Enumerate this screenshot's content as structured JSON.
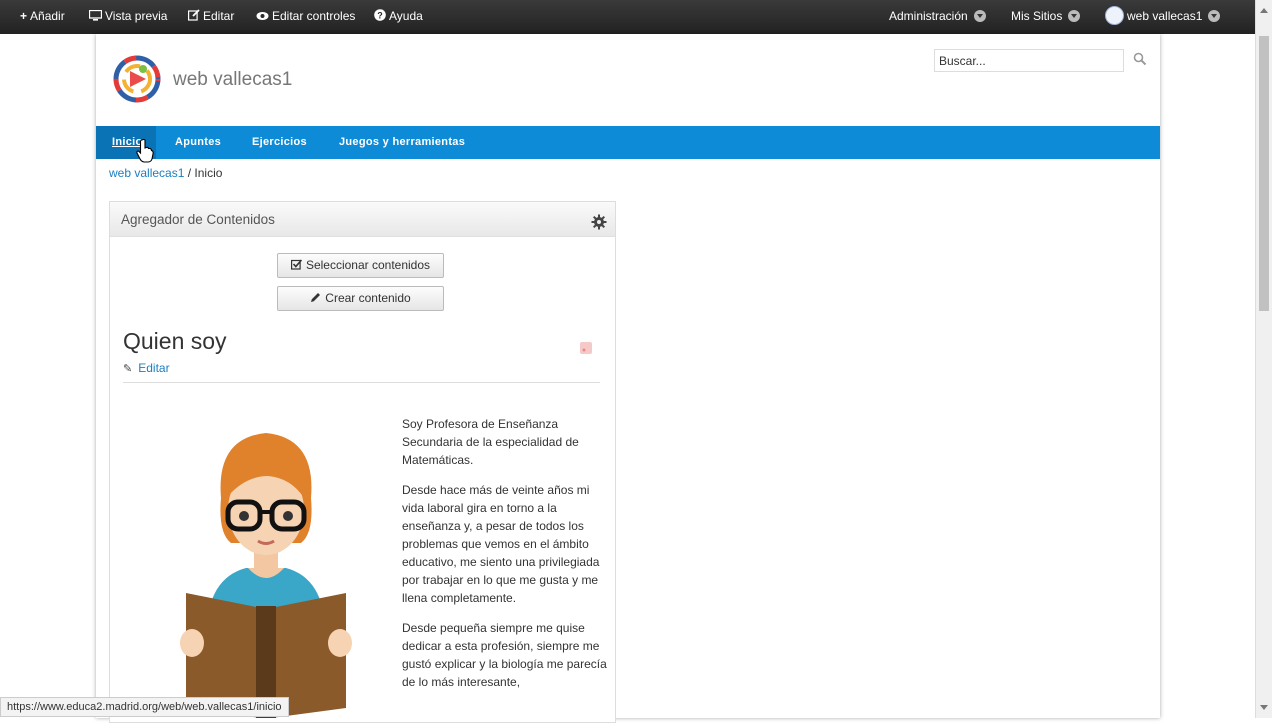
{
  "topbar": {
    "add": "Añadir",
    "preview": "Vista previa",
    "edit": "Editar",
    "edit_controls": "Editar controles",
    "help": "Ayuda",
    "admin": "Administración",
    "my_sites": "Mis Sitios",
    "user": "web vallecas1"
  },
  "header": {
    "site_name": "web vallecas1",
    "search_value": "Buscar..."
  },
  "nav": {
    "items": [
      "Inicio",
      "Apuntes",
      "Ejercicios",
      "Juegos y herramientas"
    ],
    "active": "Inicio"
  },
  "breadcrumb": {
    "site": "web vallecas1",
    "separator": "/",
    "current": "Inicio"
  },
  "portlet": {
    "title": "Agregador de Contenidos",
    "select_button": "Seleccionar contenidos",
    "create_button": "Crear contenido",
    "article_title": "Quien soy",
    "edit_link": "Editar",
    "paragraphs": [
      "Soy Profesora de Enseñanza Secundaria de la especialidad de Matemáticas.",
      "Desde hace más de veinte años mi vida laboral gira en torno a la enseñanza y, a pesar de todos los problemas que vemos en el ámbito educativo, me siento una privilegiada por trabajar en lo que me gusta y me llena completamente.",
      "Desde pequeña siempre me quise dedicar a esta profesión, siempre me gustó explicar y la biología me parecía de lo más interesante,"
    ]
  },
  "status_bar": {
    "url": "https://www.educa2.madrid.org/web/web.vallecas1/inicio"
  },
  "colors": {
    "nav_blue": "#0d8bd7",
    "link_blue": "#1c7fc1",
    "topbar": "#2b2b2b"
  }
}
